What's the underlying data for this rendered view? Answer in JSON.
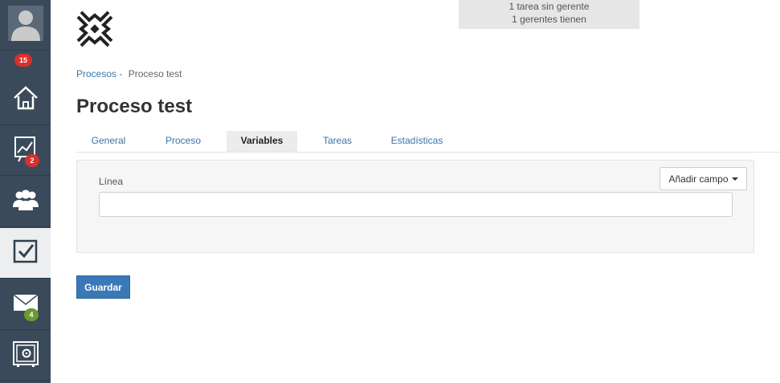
{
  "sidebar": {
    "items": [
      {
        "name": "avatar",
        "icon": "user-avatar-icon",
        "badge": "15",
        "badge_color": "#d9302c"
      },
      {
        "name": "home",
        "icon": "home-icon"
      },
      {
        "name": "reports",
        "icon": "chart-icon",
        "badge": "2",
        "badge_color": "#d9302c"
      },
      {
        "name": "groups",
        "icon": "users-icon"
      },
      {
        "name": "tasks",
        "icon": "checkbox-icon",
        "active": true
      },
      {
        "name": "messages",
        "icon": "mail-icon",
        "badge": "4",
        "badge_color": "#6b9a2e"
      },
      {
        "name": "vault",
        "icon": "safe-icon"
      }
    ]
  },
  "notice": {
    "line1": "1 tarea sin gerente",
    "line2": "1 gerentes tienen"
  },
  "breadcrumb": {
    "parent": "Procesos",
    "separator": "-",
    "current": "Proceso test"
  },
  "page": {
    "title": "Proceso test"
  },
  "tabs": [
    {
      "label": "General"
    },
    {
      "label": "Proceso"
    },
    {
      "label": "Variables",
      "active": true
    },
    {
      "label": "Tareas"
    },
    {
      "label": "Estadísticas"
    }
  ],
  "form": {
    "add_field_label": "Añadir campo",
    "field_label": "Línea",
    "field_value": "",
    "save_label": "Guardar"
  },
  "colors": {
    "sidebar_bg": "#3a4a5a",
    "link": "#3b73a8",
    "primary_button": "#3b78b8",
    "badge_red": "#d9302c",
    "badge_green": "#6b9a2e"
  }
}
